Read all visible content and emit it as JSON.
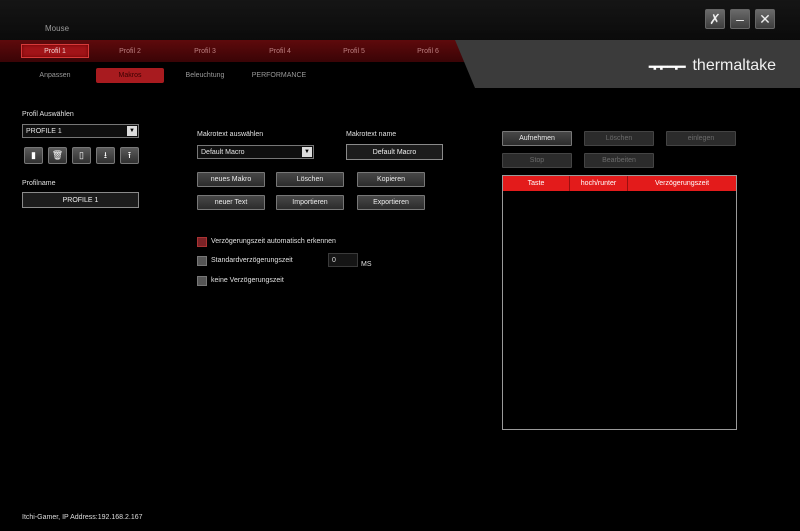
{
  "app": {
    "device": "Mouse",
    "brand": "thermaltake"
  },
  "window_controls": [
    "tools-icon",
    "minimize-icon",
    "close-icon"
  ],
  "profiles": [
    "Profil 1",
    "Profil 2",
    "Profil 3",
    "Profil 4",
    "Profil 5",
    "Profil 6"
  ],
  "active_profile": "Profil 1",
  "subtabs": [
    "Anpassen",
    "Makros",
    "Beleuchtung",
    "PERFORMANCE"
  ],
  "active_subtab": "Makros",
  "left": {
    "profile_select_label": "Profil Auswählen",
    "profile_selected": "PROFILE 1",
    "profile_icons": [
      "save-icon",
      "delete-icon",
      "copy-icon",
      "import-icon",
      "export-icon"
    ],
    "profile_name_label": "Profilname",
    "profile_name": "PROFILE 1"
  },
  "macro": {
    "select_label": "Makrotext auswählen",
    "selected": "Default Macro",
    "name_label": "Makrotext name",
    "name_value": "Default Macro",
    "buttons": {
      "new_macro": "neues Makro",
      "delete": "Löschen",
      "copy": "Kopieren",
      "new_text": "neuer Text",
      "import": "Importieren",
      "export": "Exportieren"
    },
    "options": {
      "auto_delay": "Verzögerungszeit automatisch erkennen",
      "default_delay": "Standardverzögerungszeit",
      "default_delay_value": "0",
      "default_delay_unit": "MS",
      "no_delay": "keine Verzögerungszeit"
    }
  },
  "recorder": {
    "record": "Aufnehmen",
    "delete": "Löschen",
    "insert": "einlegen",
    "stop": "Stop",
    "edit": "Bearbeiten",
    "columns": [
      "Taste",
      "hoch/runter",
      "Verzögerungszeit"
    ]
  },
  "status": "Itchi-Gamer, IP Address:192.168.2.167",
  "colors": {
    "accent": "#e31b1b",
    "strip": "#5e0a0c",
    "brand_panel": "#3b3b3b"
  }
}
